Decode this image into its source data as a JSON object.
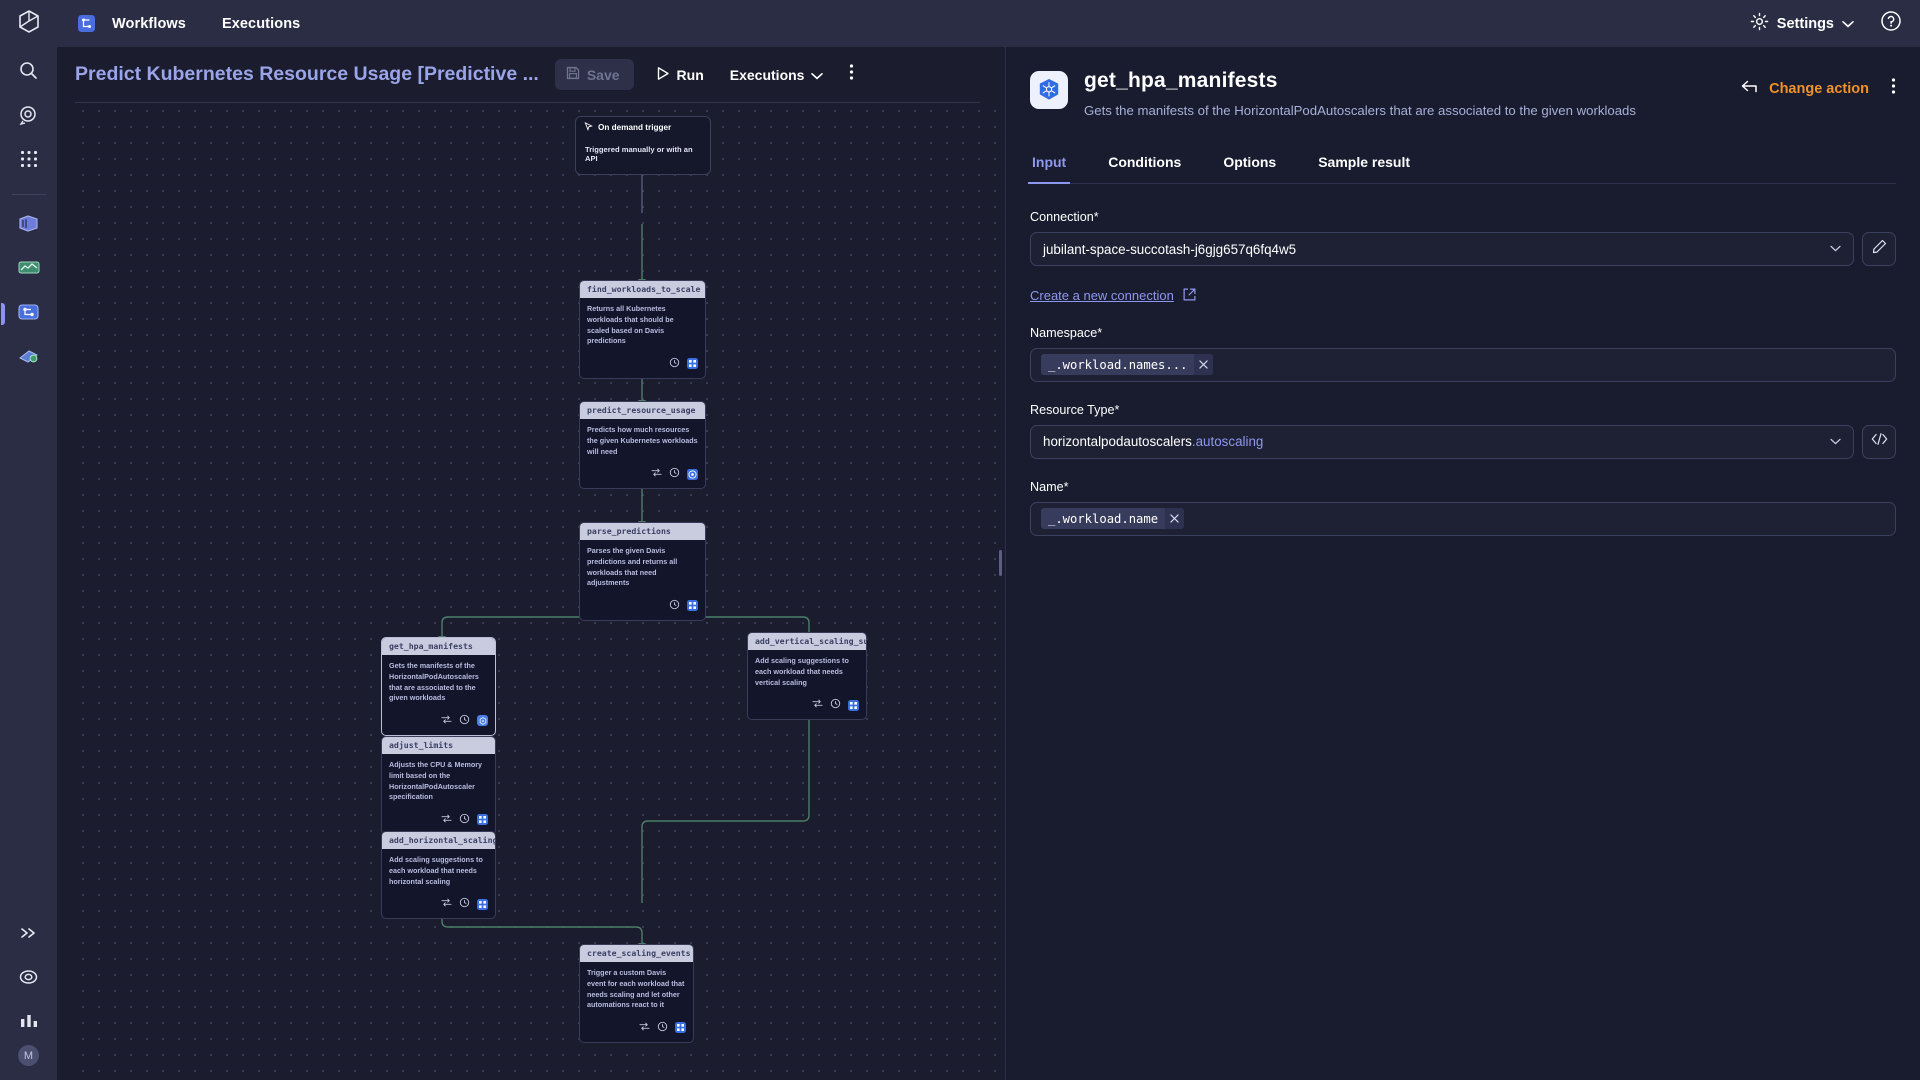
{
  "app": {
    "logo_icon": "cube-logo-icon",
    "top_nav": {
      "brand_icon": "workflows-app-icon",
      "items": [
        {
          "label": "Workflows",
          "name": "nav-workflows"
        },
        {
          "label": "Executions",
          "name": "nav-executions"
        }
      ],
      "settings_label": "Settings",
      "settings_icon": "gear-icon",
      "settings_caret": "chevron-down-icon",
      "help_icon": "help-circle-icon"
    },
    "left_rail": {
      "items": [
        {
          "name": "search-icon",
          "label": "Search"
        },
        {
          "name": "davis-ai-icon",
          "label": "Davis AI"
        },
        {
          "name": "apps-grid-icon",
          "label": "Apps"
        },
        {
          "name": "data-explorer-icon",
          "label": "Data"
        },
        {
          "name": "dashboards-icon",
          "label": "Dashboards"
        },
        {
          "name": "workflows-icon",
          "label": "Workflows",
          "active": true
        },
        {
          "name": "automations-icon",
          "label": "Automations"
        }
      ],
      "bottom_items": [
        {
          "name": "expand-chevrons-icon",
          "label": "Expand"
        },
        {
          "name": "settings-cog-icon",
          "label": "Settings"
        },
        {
          "name": "analytics-icon",
          "label": "Analytics"
        }
      ],
      "avatar_initial": "M"
    }
  },
  "workflow": {
    "title": "Predict Kubernetes Resource Usage [Predictive ...",
    "save_label": "Save",
    "save_icon": "floppy-disk-icon",
    "run_label": "Run",
    "run_icon": "play-triangle-icon",
    "executions_label": "Executions",
    "executions_caret": "chevron-down-icon",
    "more_icon": "kebab-menu-icon"
  },
  "canvas": {
    "trigger": {
      "icon": "cursor-click-icon",
      "title": "On demand trigger",
      "description": "Triggered manually or with an API"
    },
    "nodes": [
      {
        "id": "find_workloads_to_scale",
        "title": "find_workloads_to_scale",
        "description": "Returns all Kubernetes workloads that should be scaled based on Davis predictions",
        "icons": [
          "clock-icon",
          "grid-badge-icon"
        ],
        "selected": false
      },
      {
        "id": "predict_resource_usage",
        "title": "predict_resource_usage",
        "description": "Predicts how much resources the given Kubernetes workloads will need",
        "icons": [
          "loop-icon",
          "clock-icon",
          "davis-badge-icon"
        ],
        "selected": false
      },
      {
        "id": "parse_predictions",
        "title": "parse_predictions",
        "description": "Parses the given Davis predictions and returns all workloads that need adjustments",
        "icons": [
          "clock-icon",
          "grid-badge-icon"
        ],
        "selected": false
      },
      {
        "id": "get_hpa_manifests",
        "title": "get_hpa_manifests",
        "description": "Gets the manifests of the HorizontalPodAutoscalers that are associated to the given workloads",
        "icons": [
          "loop-icon",
          "clock-icon",
          "k8s-badge-icon"
        ],
        "selected": true
      },
      {
        "id": "add_vertical_scaling_suggestions",
        "title": "add_vertical_scaling_suggestions",
        "description": "Add scaling suggestions to each workload that needs vertical scaling",
        "icons": [
          "loop-icon",
          "clock-icon",
          "grid-badge-icon"
        ],
        "selected": false
      },
      {
        "id": "adjust_limits",
        "title": "adjust_limits",
        "description": "Adjusts the CPU & Memory limit based on the HorizontalPodAutoscaler specification",
        "icons": [
          "loop-icon",
          "clock-icon",
          "grid-badge-icon"
        ],
        "selected": false
      },
      {
        "id": "add_horizontal_scaling_suggestions",
        "title": "add_horizontal_scaling_suggestions",
        "description": "Add scaling suggestions to each workload that needs horizontal scaling",
        "icons": [
          "loop-icon",
          "clock-icon",
          "grid-badge-icon"
        ],
        "selected": false
      },
      {
        "id": "create_scaling_events",
        "title": "create_scaling_events",
        "description": "Trigger a custom Davis event for each workload that needs scaling and let other automations react to it",
        "icons": [
          "loop-icon",
          "clock-icon",
          "grid-badge-icon"
        ],
        "selected": false
      }
    ]
  },
  "panel": {
    "icon": "kubernetes-logo-icon",
    "title": "get_hpa_manifests",
    "subtitle": "Gets the manifests of the HorizontalPodAutoscalers that are associated to the given workloads",
    "change_action_label": "Change action",
    "change_action_icon": "back-arrow-icon",
    "more_icon": "kebab-menu-icon",
    "tabs": [
      {
        "label": "Input",
        "name": "tab-input",
        "active": true
      },
      {
        "label": "Conditions",
        "name": "tab-conditions",
        "active": false
      },
      {
        "label": "Options",
        "name": "tab-options",
        "active": false
      },
      {
        "label": "Sample result",
        "name": "tab-sample-result",
        "active": false
      }
    ],
    "form": {
      "connection": {
        "label": "Connection*",
        "value": "jubilant-space-succotash-j6gjg657q6fq4w5",
        "caret": "chevron-down-icon",
        "edit_icon": "pencil-icon"
      },
      "create_connection": {
        "label": "Create a new connection",
        "icon": "external-link-icon"
      },
      "namespace": {
        "label": "Namespace*",
        "chip": "_.workload.names...",
        "chip_remove_icon": "close-x-icon"
      },
      "resource_type": {
        "label": "Resource Type*",
        "value_main": "horizontalpodautoscalers",
        "value_sub": ".autoscaling",
        "caret": "chevron-down-icon",
        "code_icon": "code-brackets-icon"
      },
      "name": {
        "label": "Name*",
        "chip": "_.workload.name",
        "chip_remove_icon": "close-x-icon"
      }
    }
  }
}
